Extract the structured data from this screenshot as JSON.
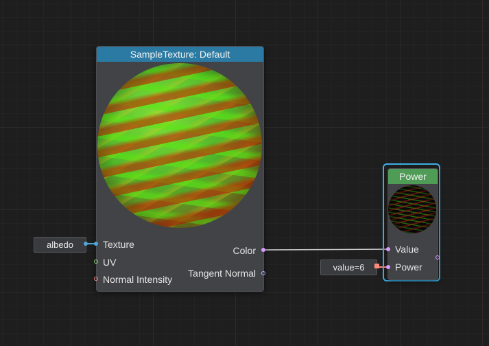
{
  "sample_texture_node": {
    "title": "SampleTexture: Default",
    "inputs": {
      "texture": "Texture",
      "uv": "UV",
      "normal_intensity": "Normal Intensity"
    },
    "outputs": {
      "color": "Color",
      "tangent_normal": "Tangent Normal"
    }
  },
  "texture_input_value": "albedo",
  "power_node": {
    "title": "Power",
    "inputs": {
      "value": "Value",
      "power": "Power"
    }
  },
  "power_input_value": "value=6",
  "colors": {
    "sample_header": "#2b7aa3",
    "power_header": "#4e9c55",
    "selection": "#3fb0e8",
    "texture_port": "#4fa8d8",
    "uv_port": "#8fe07a",
    "normal_port": "#ff8a80",
    "vector_port": "#d99cff",
    "tangent_port": "#a9b7ff",
    "float_port": "#ff8a7a"
  }
}
